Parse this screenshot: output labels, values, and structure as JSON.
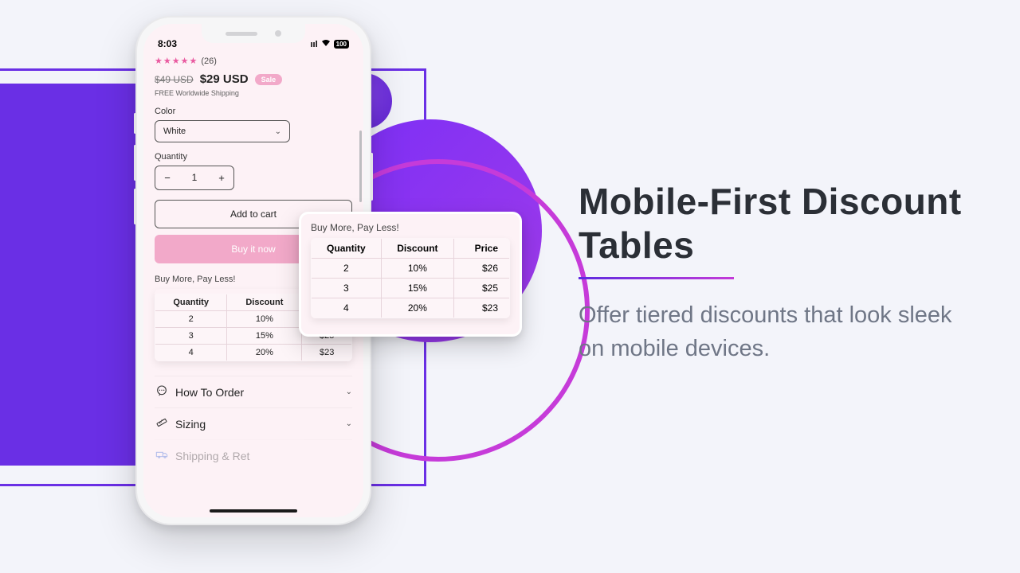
{
  "marketing": {
    "headline": "Mobile-First Discount Tables",
    "subline": "Offer tiered discounts that look sleek on mobile devices."
  },
  "status": {
    "time": "8:03",
    "battery": "100"
  },
  "product": {
    "rating_count": "(26)",
    "old_price": "$49 USD",
    "new_price": "$29 USD",
    "sale_label": "Sale",
    "shipping_note": "FREE Worldwide Shipping",
    "color_label": "Color",
    "color_value": "White",
    "quantity_label": "Quantity",
    "quantity_value": "1",
    "add_to_cart": "Add to cart",
    "buy_now": "Buy it now"
  },
  "discount": {
    "title": "Buy More, Pay Less!",
    "headers": {
      "qty": "Quantity",
      "disc": "Discount",
      "price": "Price"
    },
    "rows": [
      {
        "qty": "2",
        "disc": "10%",
        "price": "$26"
      },
      {
        "qty": "3",
        "disc": "15%",
        "price": "$25"
      },
      {
        "qty": "4",
        "disc": "20%",
        "price": "$23"
      }
    ]
  },
  "accordion": {
    "how_to_order": "How To Order",
    "sizing": "Sizing",
    "shipping": "Shipping & Ret"
  },
  "icons": {
    "star": "★",
    "chevron_down": "⌄",
    "minus": "−",
    "plus": "+",
    "chat": "💬",
    "ruler": "📏",
    "truck": "🚚",
    "signal": "▮▮▮▮",
    "wifi": "▲"
  },
  "colors": {
    "accent_purple": "#6a2fe5",
    "accent_magenta": "#c63bd9",
    "pink_fill": "#f2a9c9",
    "page_bg": "#f3f4fa"
  }
}
